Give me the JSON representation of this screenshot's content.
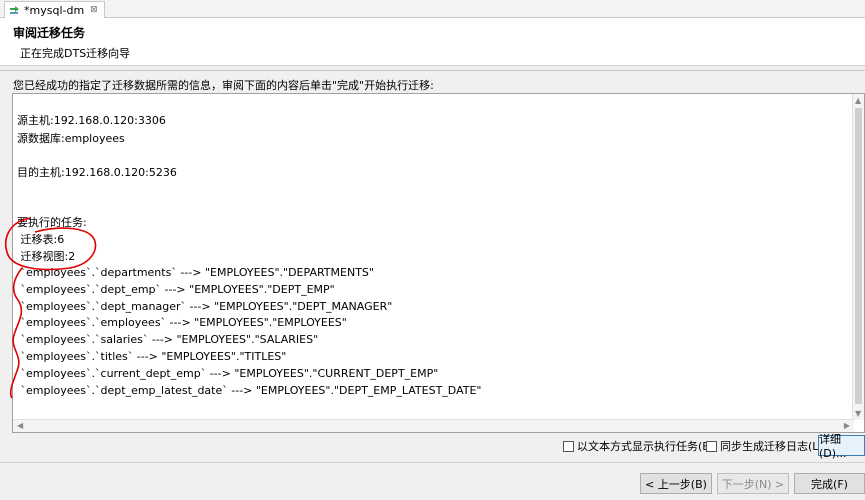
{
  "tab": {
    "title": "*mysql-dm",
    "close": "⊠"
  },
  "header": {
    "title": "审阅迁移任务",
    "subtitle": "正在完成DTS迁移向导"
  },
  "intro": "您已经成功的指定了迁移数据所需的信息，审阅下面的内容后单击\"完成\"开始执行迁移:",
  "summary": {
    "source_host": "源主机:192.168.0.120:3306",
    "source_db": "源数据库:employees",
    "target_host": "目的主机:192.168.0.120:5236",
    "tasks_heading": "要执行的任务:",
    "tables_count": " 迁移表:6",
    "views_count": " 迁移视图:2",
    "mappings": [
      " `employees`.`departments` ---> \"EMPLOYEES\".\"DEPARTMENTS\"",
      " `employees`.`dept_emp` ---> \"EMPLOYEES\".\"DEPT_EMP\"",
      " `employees`.`dept_manager` ---> \"EMPLOYEES\".\"DEPT_MANAGER\"",
      " `employees`.`employees` ---> \"EMPLOYEES\".\"EMPLOYEES\"",
      " `employees`.`salaries` ---> \"EMPLOYEES\".\"SALARIES\"",
      " `employees`.`titles` ---> \"EMPLOYEES\".\"TITLES\"",
      " `employees`.`current_dept_emp` ---> \"EMPLOYEES\".\"CURRENT_DEPT_EMP\"",
      " `employees`.`dept_emp_latest_date` ---> \"EMPLOYEES\".\"DEPT_EMP_LATEST_DATE\""
    ]
  },
  "options": {
    "show_as_text": "以文本方式显示执行任务(E)",
    "generate_log": "同步生成迁移日志(L)",
    "details": "详细(D)..."
  },
  "buttons": {
    "back": "< 上一步(B)",
    "next": "下一步(N) >",
    "finish": "完成(F)"
  },
  "colors": {
    "annotation": "#e00000",
    "tab_icon": "#3aa357",
    "focus_border": "#3c7fb1"
  },
  "icons": {
    "tab": "dm-connection-icon",
    "close": "close-icon"
  }
}
